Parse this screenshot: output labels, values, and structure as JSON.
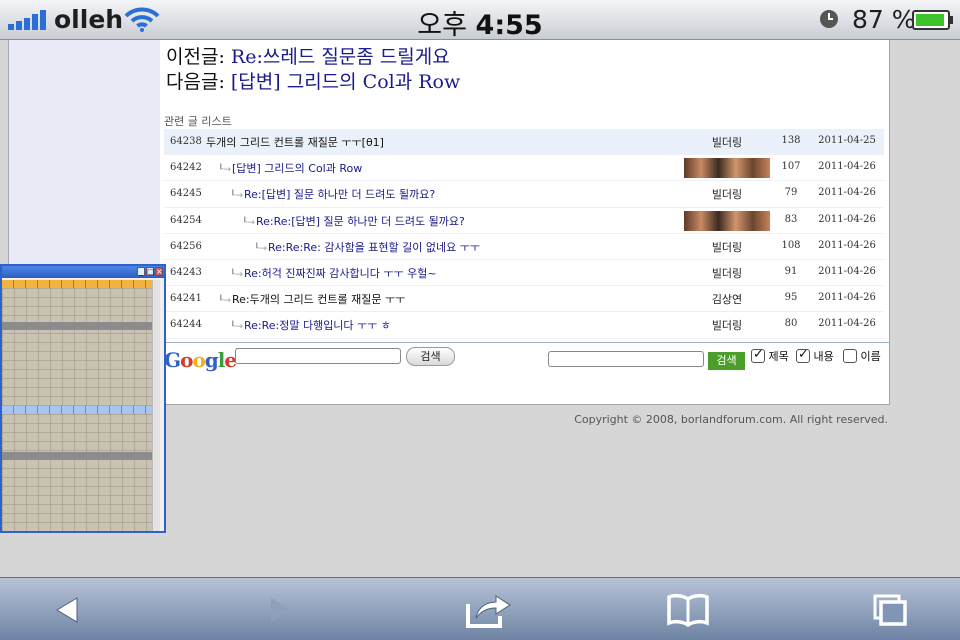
{
  "status_bar": {
    "carrier": "olleh",
    "time_prefix": "오후",
    "time": "4:55",
    "battery_percent": "87 %"
  },
  "navigation": {
    "prev_label": "이전글:",
    "prev_title": "Re:쓰레드 질문좀 드릴게요",
    "next_label": "다음글:",
    "next_title": "[답변] 그리드의 Col과 Row"
  },
  "related_list_title": "관련 글 리스트",
  "thread": [
    {
      "num": "64238",
      "title": "두개의 그리드 컨트롤 재질문 ㅜㅜ[θ1]",
      "depth": 0,
      "reply": false,
      "author": "빌더링",
      "photo": false,
      "hits": "138",
      "date": "2011-04-25",
      "highlight": true
    },
    {
      "num": "64242",
      "title": "[답변] 그리드의 Col과 Row",
      "depth": 1,
      "reply": true,
      "author": "",
      "photo": true,
      "hits": "107",
      "date": "2011-04-26",
      "highlight": false
    },
    {
      "num": "64245",
      "title": "Re:[답변] 질문 하나만 더 드려도 될까요?",
      "depth": 2,
      "reply": true,
      "author": "빌더링",
      "photo": false,
      "hits": "79",
      "date": "2011-04-26",
      "highlight": false
    },
    {
      "num": "64254",
      "title": "Re:Re:[답변] 질문 하나만 더 드려도 될까요?",
      "depth": 3,
      "reply": true,
      "author": "",
      "photo": true,
      "hits": "83",
      "date": "2011-04-26",
      "highlight": false
    },
    {
      "num": "64256",
      "title": "Re:Re:Re: 감사함을 표현할 길이 없네요 ㅜㅜ",
      "depth": 4,
      "reply": true,
      "author": "빌더링",
      "photo": false,
      "hits": "108",
      "date": "2011-04-26",
      "highlight": false
    },
    {
      "num": "64243",
      "title": "Re:허걱 진짜진짜 감사합니다 ㅜㅜ 우헐~",
      "depth": 2,
      "reply": true,
      "author": "빌더링",
      "photo": false,
      "hits": "91",
      "date": "2011-04-26",
      "highlight": false
    },
    {
      "num": "64241",
      "title": "Re:두개의 그리드 컨트롤 재질문 ㅜㅜ",
      "depth": 1,
      "reply": false,
      "author": "김상연",
      "photo": false,
      "hits": "95",
      "date": "2011-04-26",
      "highlight": false
    },
    {
      "num": "64244",
      "title": "Re:Re:정말 다행입니다 ㅜㅜ ㅎ",
      "depth": 2,
      "reply": true,
      "author": "빌더링",
      "photo": false,
      "hits": "80",
      "date": "2011-04-26",
      "highlight": false
    }
  ],
  "search": {
    "google_logo": "Google",
    "google_button": "검색",
    "site_button": "검색",
    "options": [
      {
        "label": "제목",
        "checked": true
      },
      {
        "label": "내용",
        "checked": true
      },
      {
        "label": "이름",
        "checked": false
      }
    ]
  },
  "copyright": "Copyright © 2008, borlandforum.com. All right reserved.",
  "colors": {
    "link": "#1a1a8a",
    "search_button": "#4c9e2b",
    "toolbar": "#8196b4",
    "battery": "#3cc32a"
  },
  "icons": {
    "toolbar": [
      "back-arrow-icon",
      "forward-arrow-icon",
      "share-icon",
      "bookmarks-icon",
      "pages-icon"
    ],
    "status": [
      "signal-strength-icon",
      "wifi-icon",
      "alarm-clock-icon",
      "battery-icon"
    ]
  }
}
